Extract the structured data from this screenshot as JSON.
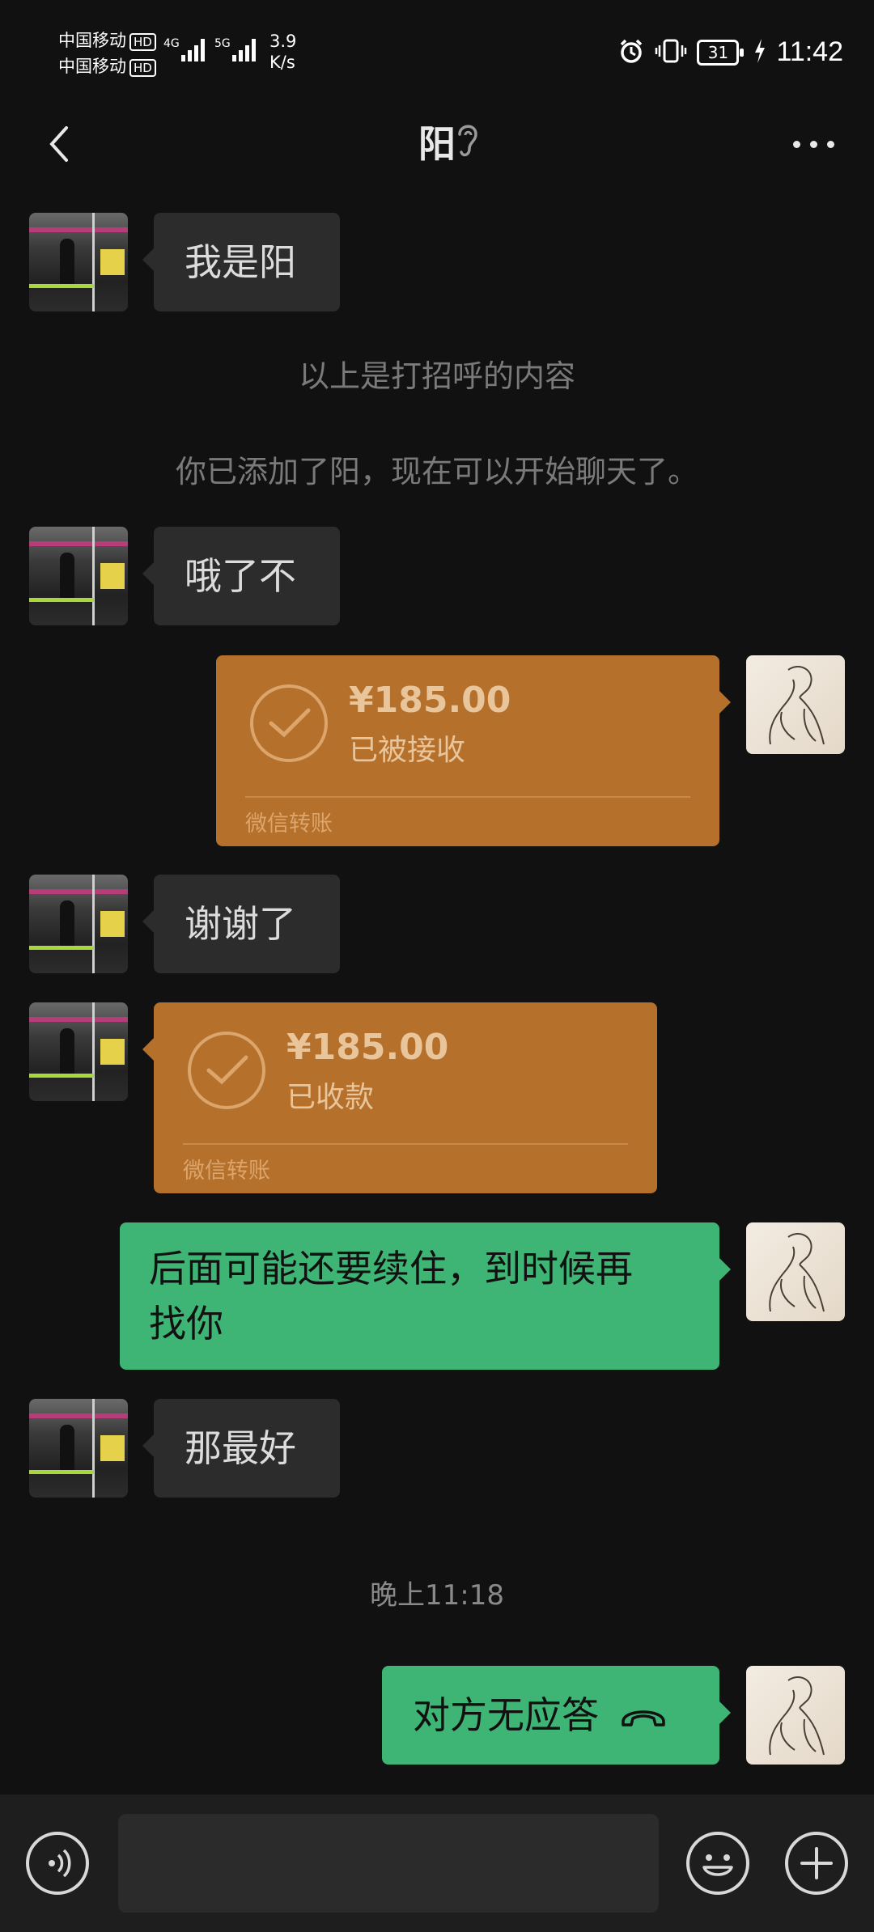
{
  "status_bar": {
    "carrier_1": "中国移动",
    "carrier_2": "中国移动",
    "hd_label": "HD",
    "net_1": "4G",
    "net_2": "5G",
    "speed_value": "3.9",
    "speed_unit": "K/s",
    "battery": "31",
    "time": "11:42"
  },
  "header": {
    "title": "阳"
  },
  "messages": {
    "m1": "我是阳",
    "sys1": "以上是打招呼的内容",
    "sys2": "你已添加了阳，现在可以开始聊天了。",
    "m2": "哦了不",
    "t1_amount": "¥185.00",
    "t1_status": "已被接收",
    "t1_label": "微信转账",
    "m3": "谢谢了",
    "t2_amount": "¥185.00",
    "t2_status": "已收款",
    "t2_label": "微信转账",
    "m4_line1": "后面可能还要续住，到时候再",
    "m4_line2": "找你",
    "m5": "那最好",
    "timestamp": "晚上11:18",
    "m6": "对方无应答"
  },
  "colors": {
    "background": "#111111",
    "incoming_bubble": "#2c2c2c",
    "outgoing_bubble": "#3eb575",
    "transfer_card": "#b5702b"
  }
}
